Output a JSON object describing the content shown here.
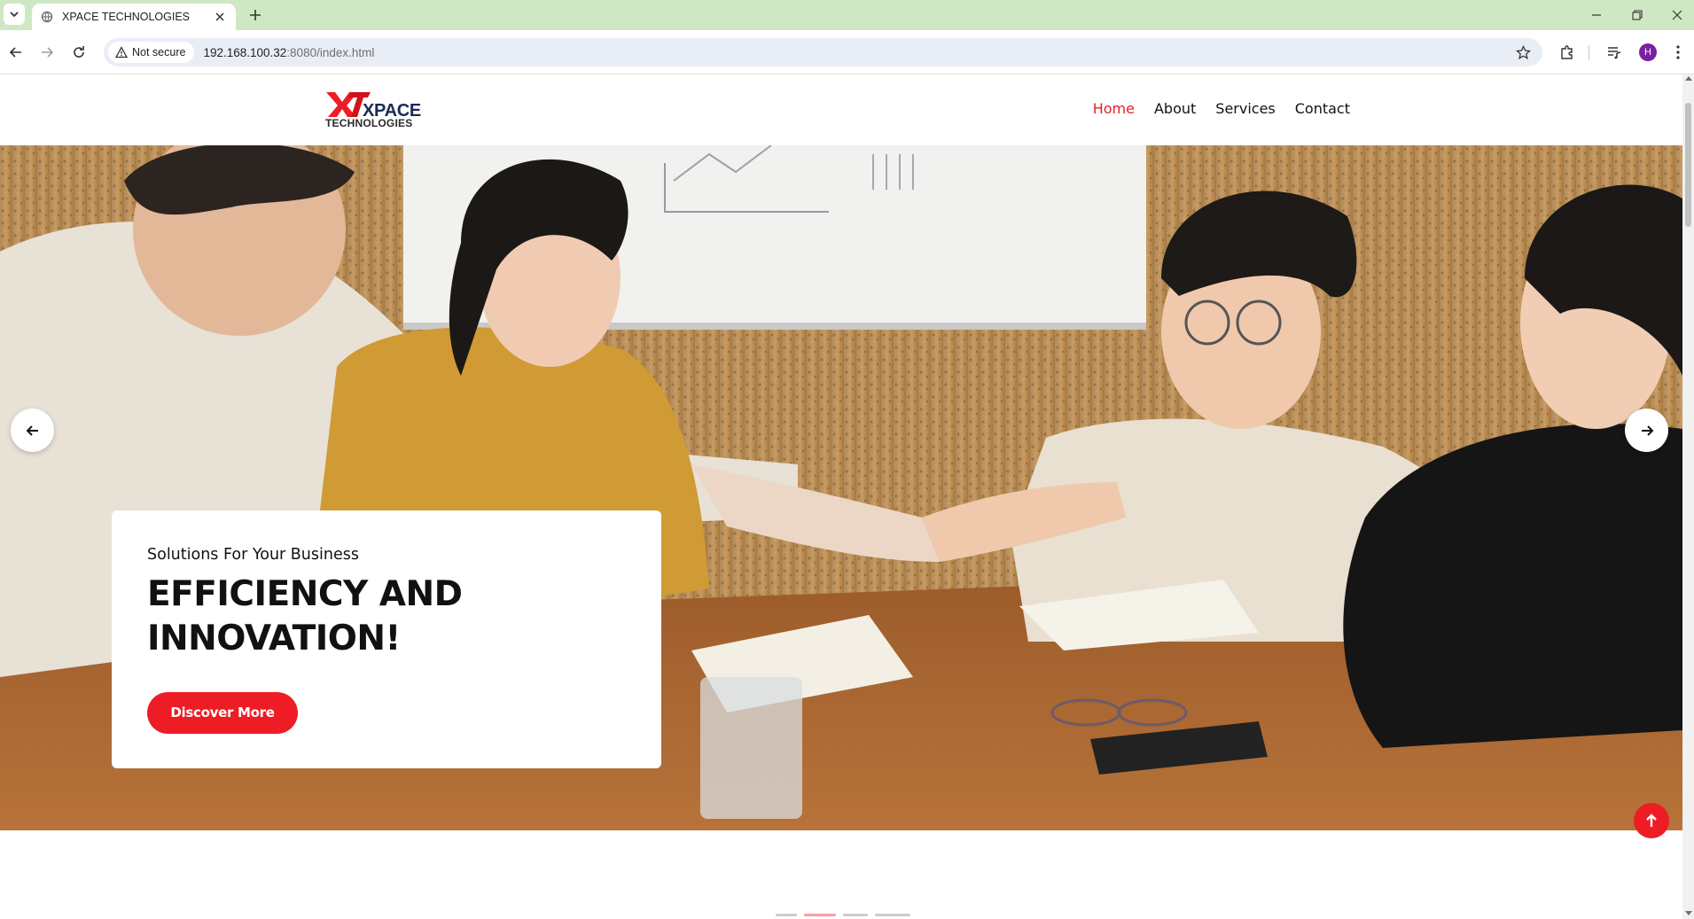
{
  "browser": {
    "tab_title": "XPACE TECHNOLOGIES",
    "security_label": "Not secure",
    "url_host": "192.168.100.32",
    "url_rest": ":8080/index.html",
    "profile_initial": "H"
  },
  "site": {
    "logo": {
      "mark": "XT",
      "name": "XPACE",
      "tagline": "TECHNOLOGIES"
    },
    "nav": [
      {
        "label": "Home",
        "active": true
      },
      {
        "label": "About",
        "active": false
      },
      {
        "label": "Services",
        "active": false
      },
      {
        "label": "Contact",
        "active": false
      }
    ]
  },
  "hero": {
    "subtitle": "Solutions For Your Business",
    "title_line1": "EFFICIENCY AND",
    "title_line2": "INNOVATION!",
    "cta_label": "Discover More"
  },
  "colors": {
    "accent": "#ee1c25",
    "logo_navy": "#1c2a55",
    "tabstrip": "#cfe8c4"
  },
  "icons": {
    "prev": "arrow-left-icon",
    "next": "arrow-right-icon",
    "scroll_top": "arrow-up-icon"
  }
}
